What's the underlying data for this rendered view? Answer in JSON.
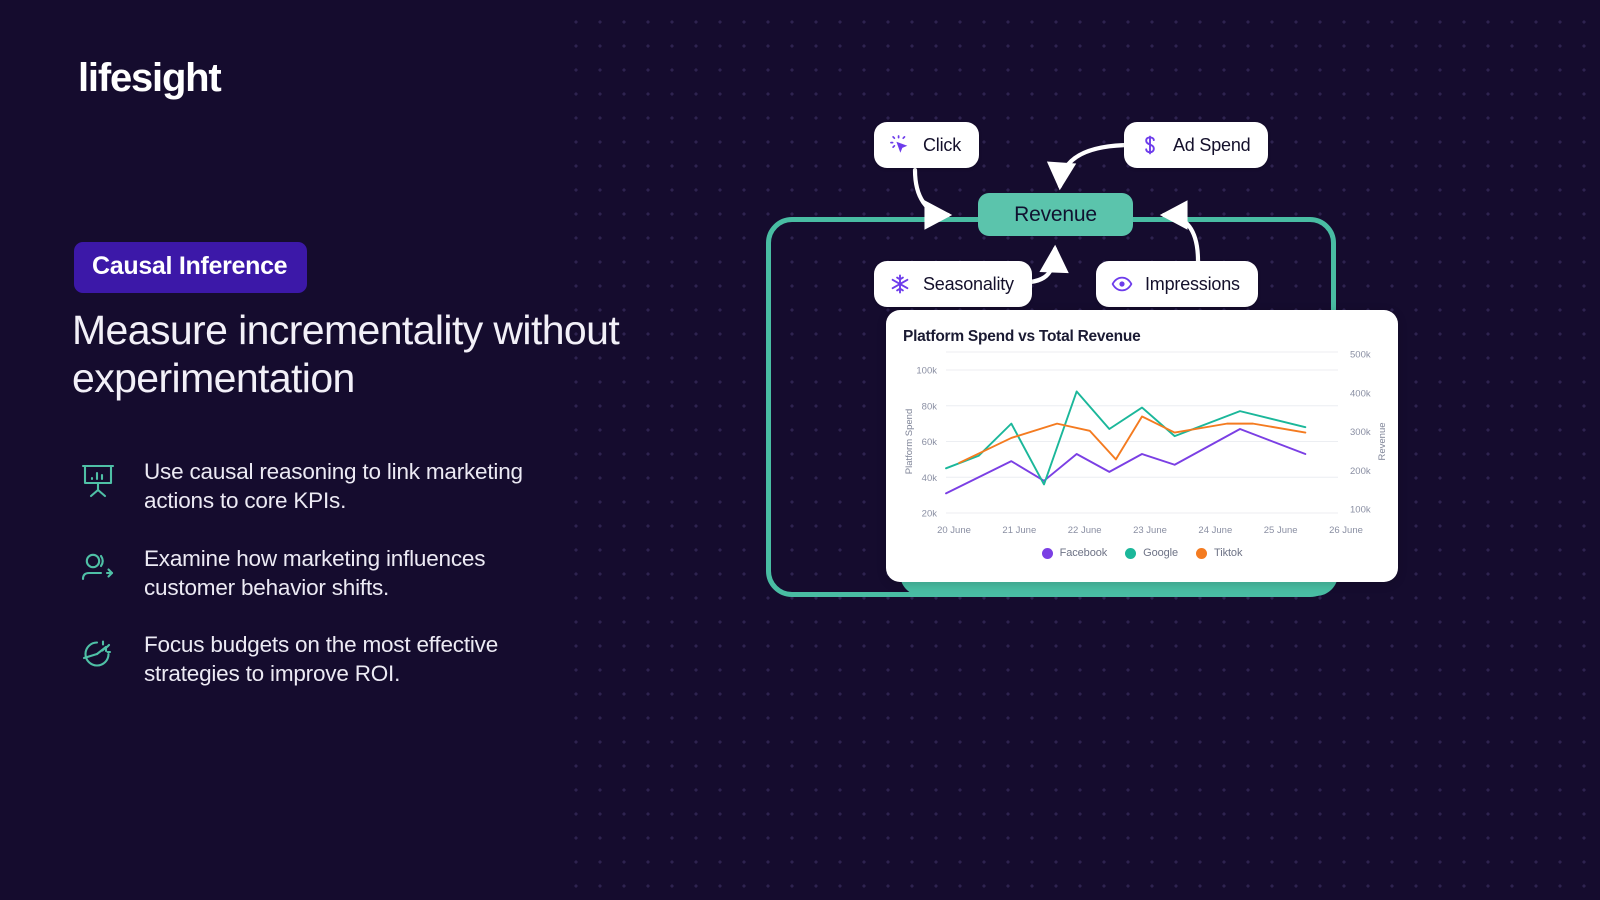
{
  "brand": {
    "logo_text": "lifesight"
  },
  "hero": {
    "badge": "Causal Inference",
    "headline": "Measure incrementality without experimentation"
  },
  "features": [
    {
      "icon": "presentation-chart-icon",
      "text": "Use causal reasoning to link marketing actions to core KPIs."
    },
    {
      "icon": "customer-behavior-arrow-icon",
      "text": "Examine how marketing influences customer behavior shifts."
    },
    {
      "icon": "pie-chart-target-icon",
      "text": "Focus budgets on the most effective strategies to improve ROI."
    }
  ],
  "diagram": {
    "nodes": [
      {
        "id": "click",
        "label": "Click",
        "icon": "cursor-click-icon"
      },
      {
        "id": "adspend",
        "label": "Ad Spend",
        "icon": "dollar-sign-icon"
      },
      {
        "id": "seasonality",
        "label": "Seasonality",
        "icon": "snowflake-icon"
      },
      {
        "id": "impressions",
        "label": "Impressions",
        "icon": "eye-icon"
      },
      {
        "id": "revenue",
        "label": "Revenue",
        "icon": "none"
      }
    ],
    "colors": {
      "accent_teal": "#49bda3",
      "revenue_fill": "#5bc4ac",
      "node_icon_purple": "#6d3ceb"
    }
  },
  "chart_data": {
    "type": "line",
    "title": "Platform Spend vs Total Revenue",
    "xlabel": "",
    "ylabel": "Platform Spend",
    "y2label": "Revenue",
    "categories": [
      "20 June",
      "21 June",
      "22 June",
      "23 June",
      "24 June",
      "25 June",
      "26 June"
    ],
    "x_tick_labels": [
      "20 June",
      "21 June",
      "22 June",
      "23 June",
      "24 June",
      "25 June",
      "26 June"
    ],
    "y_tick_labels": [
      "20k",
      "40k",
      "60k",
      "80k",
      "100k"
    ],
    "y2_tick_labels": [
      "100k",
      "200k",
      "300k",
      "400k",
      "500k"
    ],
    "ylim": [
      20000,
      100000
    ],
    "y2lim": [
      50000,
      500000
    ],
    "grid": true,
    "legend_position": "bottom",
    "series": [
      {
        "name": "Facebook",
        "color": "#7b3fe4",
        "values": [
          31000,
          40000,
          49000,
          38000,
          53000,
          43000,
          53000,
          47000,
          67000,
          53000
        ],
        "x_points": [
          0,
          0.5,
          1,
          1.5,
          2,
          2.5,
          3,
          3.5,
          4.5,
          5.5
        ]
      },
      {
        "name": "Google",
        "color": "#1bb79a",
        "values": [
          45000,
          52000,
          70000,
          36000,
          88000,
          67000,
          79000,
          63000,
          77000,
          68000
        ],
        "x_points": [
          0,
          0.5,
          1,
          1.5,
          2,
          2.5,
          3,
          3.5,
          4.5,
          5.5
        ]
      },
      {
        "name": "Tiktok",
        "color": "#f47b20",
        "values": [
          48000,
          62000,
          70000,
          66000,
          50000,
          74000,
          65000,
          70000,
          70000,
          65000
        ],
        "x_points": [
          0.2,
          1,
          1.7,
          2.2,
          2.6,
          3,
          3.5,
          4.3,
          4.7,
          5.5
        ]
      }
    ],
    "legend": [
      {
        "label": "Facebook",
        "color": "#7b3fe4"
      },
      {
        "label": "Google",
        "color": "#1bb79a"
      },
      {
        "label": "Tiktok",
        "color": "#f47b20"
      }
    ]
  }
}
